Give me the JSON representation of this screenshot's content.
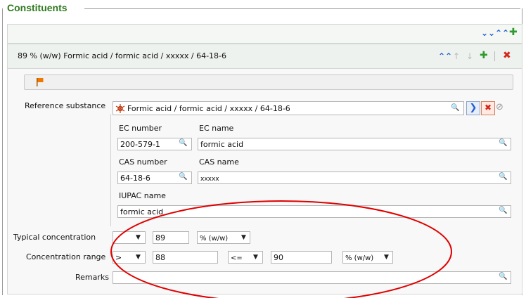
{
  "section": {
    "title": "Constituents"
  },
  "header": {
    "title": "89 % (w/w) Formic acid / formic acid / xxxxx / 64-18-6"
  },
  "reference_substance": {
    "label": "Reference substance",
    "value": "Formic acid / formic acid / xxxxx / 64-18-6",
    "ec_number": {
      "label": "EC number",
      "value": "200-579-1"
    },
    "ec_name": {
      "label": "EC name",
      "value": "formic acid"
    },
    "cas_number": {
      "label": "CAS number",
      "value": "64-18-6"
    },
    "cas_name": {
      "label": "CAS name",
      "value": "xxxxx"
    },
    "iupac_name": {
      "label": "IUPAC name",
      "value": "formic acid"
    }
  },
  "typical_concentration": {
    "label": "Typical concentration",
    "qualifier": "",
    "value": "89",
    "unit": "% (w/w)"
  },
  "concentration_range": {
    "label": "Concentration range",
    "lower_qualifier": ">",
    "lower_value": "88",
    "upper_qualifier": "<=",
    "upper_value": "90",
    "unit": "% (w/w)"
  },
  "remarks": {
    "label": "Remarks",
    "value": ""
  },
  "colors": {
    "title_green": "#2f7a1f",
    "accent_blue": "#1f5fd1",
    "delete_red": "#d6251b",
    "annotation_red": "#e00000"
  }
}
